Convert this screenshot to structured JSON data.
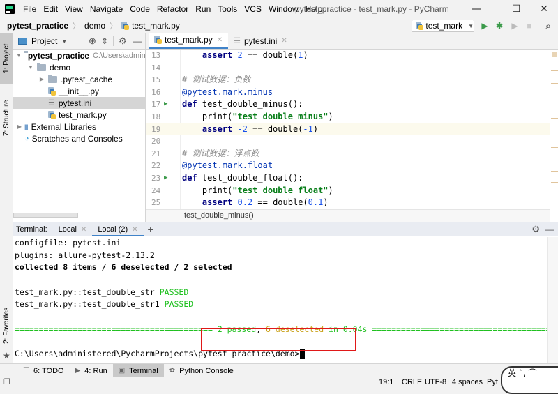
{
  "window": {
    "title": "pytest_practice - test_mark.py - PyCharm",
    "menu": [
      "File",
      "Edit",
      "View",
      "Navigate",
      "Code",
      "Refactor",
      "Run",
      "Tools",
      "VCS",
      "Window",
      "Help"
    ],
    "controls": {
      "minimize": "—",
      "maximize": "☐",
      "close": "✕"
    }
  },
  "navbar": {
    "breadcrumbs": [
      "pytest_practice",
      "demo",
      "test_mark.py"
    ],
    "run_config": "test_mark",
    "icons": {
      "run": "▶",
      "debug": "✱",
      "coverage": "▶",
      "stop": "■",
      "search": "⌕"
    }
  },
  "left_strip": {
    "tabs": [
      "1: Project",
      "7: Structure",
      "2: Favorites"
    ]
  },
  "project_panel": {
    "title": "Project",
    "tree": [
      {
        "label": "pytest_practice",
        "hint": "C:\\Users\\adminis",
        "type": "folder",
        "expanded": true,
        "depth": 0,
        "bold": true
      },
      {
        "label": "demo",
        "type": "folder",
        "expanded": true,
        "depth": 1
      },
      {
        "label": ".pytest_cache",
        "type": "folder",
        "expanded": false,
        "depth": 2
      },
      {
        "label": "__init__.py",
        "type": "py",
        "depth": 2
      },
      {
        "label": "pytest.ini",
        "type": "ini",
        "depth": 2,
        "selected": true
      },
      {
        "label": "test_mark.py",
        "type": "py",
        "depth": 2
      },
      {
        "label": "External Libraries",
        "type": "lib",
        "depth": 0,
        "expanded": false
      },
      {
        "label": "Scratches and Consoles",
        "type": "scratch",
        "depth": 0
      }
    ]
  },
  "editor": {
    "tabs": [
      {
        "label": "test_mark.py",
        "active": true
      },
      {
        "label": "pytest.ini",
        "active": false
      }
    ],
    "lines": [
      {
        "n": "13",
        "parts": [
          [
            "",
            "    "
          ],
          [
            "kw",
            "assert "
          ],
          [
            "num",
            "2"
          ],
          [
            "fn",
            " == double("
          ],
          [
            "num",
            "1"
          ],
          [
            "fn",
            ")"
          ]
        ]
      },
      {
        "n": "14",
        "parts": []
      },
      {
        "n": "15",
        "parts": [
          [
            "com",
            "# 测试数据：负数"
          ]
        ]
      },
      {
        "n": "16",
        "parts": [
          [
            "deco",
            "@pytest.mark.minus"
          ]
        ]
      },
      {
        "n": "17",
        "run": true,
        "parts": [
          [
            "kw",
            "def "
          ],
          [
            "fn",
            "test_double_minus():"
          ]
        ]
      },
      {
        "n": "18",
        "parts": [
          [
            "",
            "    "
          ],
          [
            "fn",
            "print("
          ],
          [
            "str",
            "\"test double minus\""
          ],
          [
            "fn",
            ")"
          ]
        ]
      },
      {
        "n": "19",
        "current": true,
        "parts": [
          [
            "",
            "    "
          ],
          [
            "kw",
            "assert "
          ],
          [
            "num",
            "-2"
          ],
          [
            "fn",
            " == double("
          ],
          [
            "num",
            "-1"
          ],
          [
            "fn",
            ")"
          ]
        ]
      },
      {
        "n": "20",
        "parts": []
      },
      {
        "n": "21",
        "parts": [
          [
            "com",
            "# 测试数据：浮点数"
          ]
        ]
      },
      {
        "n": "22",
        "parts": [
          [
            "deco",
            "@pytest.mark.float"
          ]
        ]
      },
      {
        "n": "23",
        "run": true,
        "parts": [
          [
            "kw",
            "def "
          ],
          [
            "fn",
            "test_double_float():"
          ]
        ]
      },
      {
        "n": "24",
        "parts": [
          [
            "",
            "    "
          ],
          [
            "fn",
            "print("
          ],
          [
            "str",
            "\"test double float\""
          ],
          [
            "fn",
            ")"
          ]
        ]
      },
      {
        "n": "25",
        "parts": [
          [
            "",
            "    "
          ],
          [
            "kw",
            "assert "
          ],
          [
            "num",
            "0.2"
          ],
          [
            "fn",
            " == double("
          ],
          [
            "num",
            "0.1"
          ],
          [
            "fn",
            ")"
          ]
        ]
      }
    ],
    "breadcrumb": "test_double_minus()"
  },
  "terminal": {
    "label": "Terminal:",
    "tabs": [
      {
        "label": "Local",
        "active": false
      },
      {
        "label": "Local (2)",
        "active": true
      }
    ],
    "add": "+",
    "lines": {
      "l1": "configfile: pytest.ini",
      "l2": "plugins: allure-pytest-2.13.2",
      "l3": "collected 8 items / 6 deselected / 2 selected",
      "r1_name": "test_mark.py::test_double_str ",
      "r1_status": "PASSED",
      "r2_name": "test_mark.py::test_double_str1 ",
      "r2_status": "PASSED",
      "sep_left": "========================================= ",
      "sum_passed": "2 passed",
      "sum_comma": ", ",
      "sum_deselected": "6 deselected",
      "sum_time": " in 0.04s ",
      "sep_right": "=========================================",
      "prompt": "C:\\Users\\administered\\PycharmProjects\\pytest_practice\\demo>"
    }
  },
  "bottom_tools": [
    {
      "label": "6: TODO",
      "icon": "☰",
      "active": false
    },
    {
      "label": "4: Run",
      "icon": "▶",
      "active": false
    },
    {
      "label": "Terminal",
      "icon": "▣",
      "active": true
    },
    {
      "label": "Python Console",
      "icon": "✿",
      "active": false
    }
  ],
  "status_bar": {
    "position": "19:1",
    "line_sep": "CRLF",
    "encoding": "UTF-8",
    "indent": "4 spaces",
    "interpreter": "Pyt"
  },
  "sticker": {
    "text": "英 ˋ, ⌒"
  }
}
